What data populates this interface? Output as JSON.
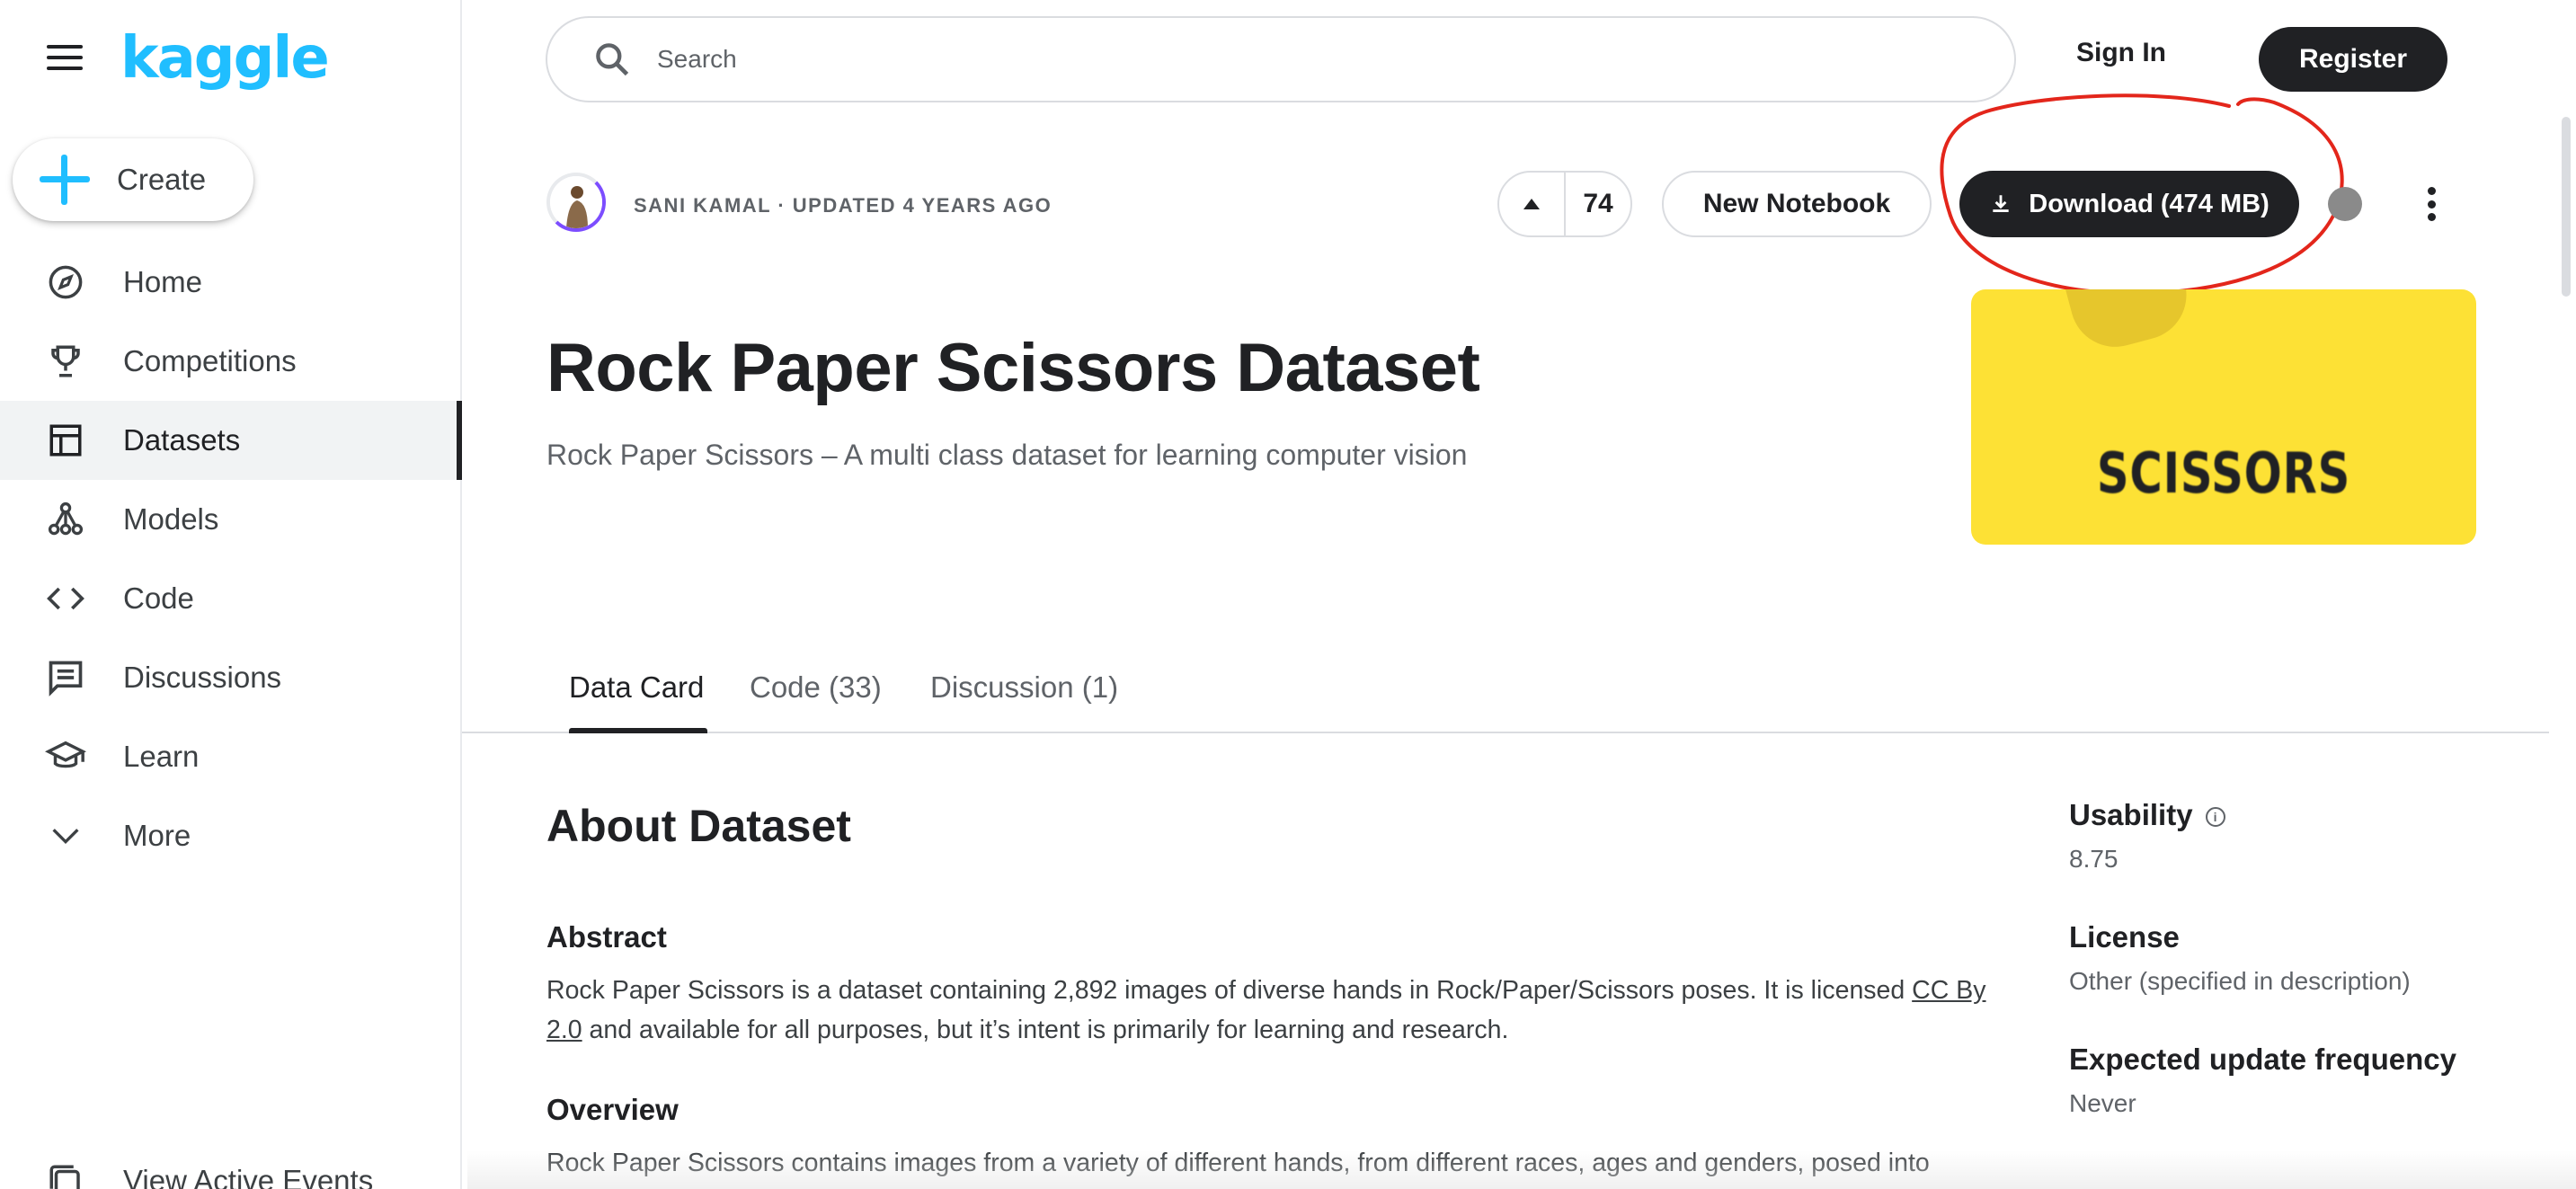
{
  "sidebar": {
    "logo": "kaggle",
    "create_label": "Create",
    "items": [
      {
        "label": "Home",
        "icon": "compass-icon"
      },
      {
        "label": "Competitions",
        "icon": "trophy-icon"
      },
      {
        "label": "Datasets",
        "icon": "table-icon",
        "active": true
      },
      {
        "label": "Models",
        "icon": "models-icon"
      },
      {
        "label": "Code",
        "icon": "code-icon"
      },
      {
        "label": "Discussions",
        "icon": "discussion-icon"
      },
      {
        "label": "Learn",
        "icon": "graduation-cap-icon"
      },
      {
        "label": "More",
        "icon": "chevron-down-icon"
      }
    ],
    "footer_label": "View Active Events"
  },
  "header": {
    "search_placeholder": "Search",
    "signin_label": "Sign In",
    "register_label": "Register"
  },
  "dataset": {
    "author_line": "SANI KAMAL · UPDATED 4 YEARS AGO",
    "vote_count": "74",
    "new_notebook_label": "New Notebook",
    "download_label": "Download (474 MB)",
    "title": "Rock Paper Scissors Dataset",
    "subtitle": "Rock Paper Scissors – A multi class dataset for learning computer vision",
    "cover_text": "SCISSORS",
    "cover_color": "#fde135"
  },
  "tabs": [
    {
      "label": "Data Card",
      "active": true
    },
    {
      "label": "Code (33)"
    },
    {
      "label": "Discussion (1)"
    }
  ],
  "about": {
    "title": "About Dataset",
    "abstract_heading": "Abstract",
    "abstract_text_1": "Rock Paper Scissors is a dataset containing 2,892 images of diverse hands in Rock/Paper/Scissors poses. It is licensed ",
    "abstract_link": "CC By 2.0",
    "abstract_text_2": " and available for all purposes, but it’s intent is primarily for learning and research.",
    "overview_heading": "Overview",
    "overview_text": "Rock Paper Scissors contains images from a variety of different hands, from different races, ages and genders, posed into"
  },
  "meta": {
    "usability_label": "Usability",
    "usability_value": "8.75",
    "license_label": "License",
    "license_value": "Other (specified in description)",
    "frequency_label": "Expected update frequency",
    "frequency_value": "Never"
  },
  "colors": {
    "brand": "#20beff",
    "primary_dark": "#202124",
    "annotation_red": "#e3261b"
  }
}
